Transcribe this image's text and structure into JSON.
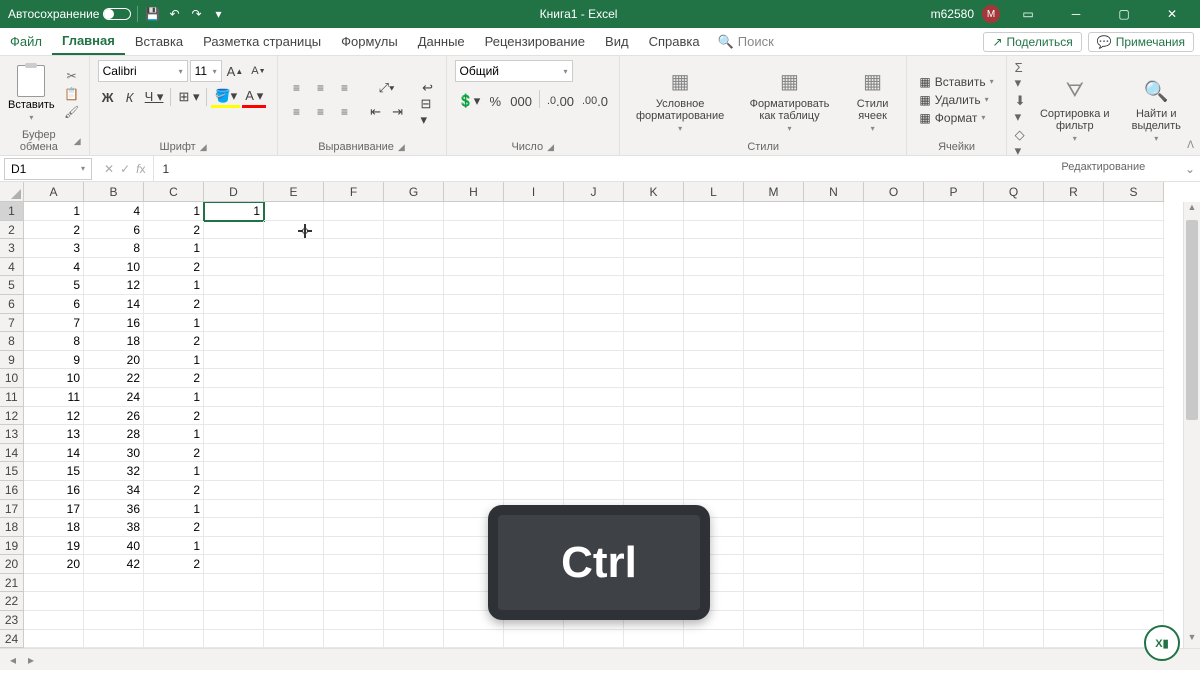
{
  "titlebar": {
    "autosave_label": "Автосохранение",
    "document_title": "Книга1 - Excel",
    "user_short": "m62580",
    "user_initial": "M"
  },
  "menu": {
    "file": "Файл",
    "home": "Главная",
    "insert": "Вставка",
    "page_layout": "Разметка страницы",
    "formulas": "Формулы",
    "data": "Данные",
    "review": "Рецензирование",
    "view": "Вид",
    "help": "Справка",
    "search": "Поиск",
    "share": "Поделиться",
    "comments": "Примечания"
  },
  "ribbon": {
    "clipboard": {
      "paste": "Вставить",
      "group": "Буфер обмена"
    },
    "font": {
      "name": "Calibri",
      "size": "11",
      "group": "Шрифт"
    },
    "alignment": {
      "group": "Выравнивание"
    },
    "number": {
      "format": "Общий",
      "group": "Число"
    },
    "styles": {
      "conditional": "Условное форматирование",
      "as_table": "Форматировать как таблицу",
      "cell_styles": "Стили ячеек",
      "group": "Стили"
    },
    "cells": {
      "insert": "Вставить",
      "delete": "Удалить",
      "format": "Формат",
      "group": "Ячейки"
    },
    "editing": {
      "sort": "Сортировка и фильтр",
      "find": "Найти и выделить",
      "group": "Редактирование"
    }
  },
  "formula_bar": {
    "name_box": "D1",
    "formula": "1"
  },
  "grid": {
    "columns": [
      "A",
      "B",
      "C",
      "D",
      "E",
      "F",
      "G",
      "H",
      "I",
      "J",
      "K",
      "L",
      "M",
      "N",
      "O",
      "P",
      "Q",
      "R",
      "S"
    ],
    "rows": [
      {
        "n": 1,
        "A": "1",
        "B": "4",
        "C": "1",
        "D": "1"
      },
      {
        "n": 2,
        "A": "2",
        "B": "6",
        "C": "2",
        "D": ""
      },
      {
        "n": 3,
        "A": "3",
        "B": "8",
        "C": "1",
        "D": ""
      },
      {
        "n": 4,
        "A": "4",
        "B": "10",
        "C": "2",
        "D": ""
      },
      {
        "n": 5,
        "A": "5",
        "B": "12",
        "C": "1",
        "D": ""
      },
      {
        "n": 6,
        "A": "6",
        "B": "14",
        "C": "2",
        "D": ""
      },
      {
        "n": 7,
        "A": "7",
        "B": "16",
        "C": "1",
        "D": ""
      },
      {
        "n": 8,
        "A": "8",
        "B": "18",
        "C": "2",
        "D": ""
      },
      {
        "n": 9,
        "A": "9",
        "B": "20",
        "C": "1",
        "D": ""
      },
      {
        "n": 10,
        "A": "10",
        "B": "22",
        "C": "2",
        "D": ""
      },
      {
        "n": 11,
        "A": "11",
        "B": "24",
        "C": "1",
        "D": ""
      },
      {
        "n": 12,
        "A": "12",
        "B": "26",
        "C": "2",
        "D": ""
      },
      {
        "n": 13,
        "A": "13",
        "B": "28",
        "C": "1",
        "D": ""
      },
      {
        "n": 14,
        "A": "14",
        "B": "30",
        "C": "2",
        "D": ""
      },
      {
        "n": 15,
        "A": "15",
        "B": "32",
        "C": "1",
        "D": ""
      },
      {
        "n": 16,
        "A": "16",
        "B": "34",
        "C": "2",
        "D": ""
      },
      {
        "n": 17,
        "A": "17",
        "B": "36",
        "C": "1",
        "D": ""
      },
      {
        "n": 18,
        "A": "18",
        "B": "38",
        "C": "2",
        "D": ""
      },
      {
        "n": 19,
        "A": "19",
        "B": "40",
        "C": "1",
        "D": ""
      },
      {
        "n": 20,
        "A": "20",
        "B": "42",
        "C": "2",
        "D": ""
      },
      {
        "n": 21,
        "A": "",
        "B": "",
        "C": "",
        "D": ""
      },
      {
        "n": 22,
        "A": "",
        "B": "",
        "C": "",
        "D": ""
      },
      {
        "n": 23,
        "A": "",
        "B": "",
        "C": "",
        "D": ""
      },
      {
        "n": 24,
        "A": "",
        "B": "",
        "C": "",
        "D": ""
      }
    ],
    "selected_cell": "D1"
  },
  "overlay": {
    "key": "Ctrl"
  }
}
